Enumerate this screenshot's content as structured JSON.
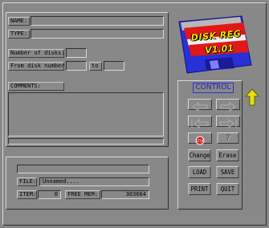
{
  "labels": {
    "name": "NAME:",
    "type": "TYPE:",
    "num_disks": "Number of disks:",
    "from_disk": "From disk number",
    "to": "to",
    "comments": "COMMENTS:",
    "file": "FILE:",
    "item": "ITEM:",
    "free_mem": "FREE MEM:"
  },
  "fields": {
    "name": "",
    "type": "",
    "num_disks": "",
    "from_disk": "",
    "to_disk": "",
    "file": "Unnamed....",
    "item": "0",
    "free_mem": "303664"
  },
  "logo": {
    "line1": "DISK REG",
    "line2": "V1.01"
  },
  "control": {
    "title": "CONTROL",
    "buttons": {
      "change": "Change",
      "erase": "Erase",
      "load": "LOAD",
      "save": "SAVE",
      "print": "PRINT",
      "quit": "QUIT",
      "help": "?",
      "stop": "STOP"
    }
  },
  "colors": {
    "background": "#888888",
    "logo_red": "#e01818",
    "logo_blue": "#2830d8",
    "logo_text": "#f0e000",
    "control_title": "#2020c8",
    "arrow_yellow": "#e8e010"
  },
  "icons": {
    "prev": "left-arrow-icon",
    "next": "right-arrow-icon",
    "first": "first-record-icon",
    "last": "last-record-icon",
    "stop": "stop-sign-icon",
    "help": "question-mark-icon",
    "up": "up-arrow-icon"
  }
}
